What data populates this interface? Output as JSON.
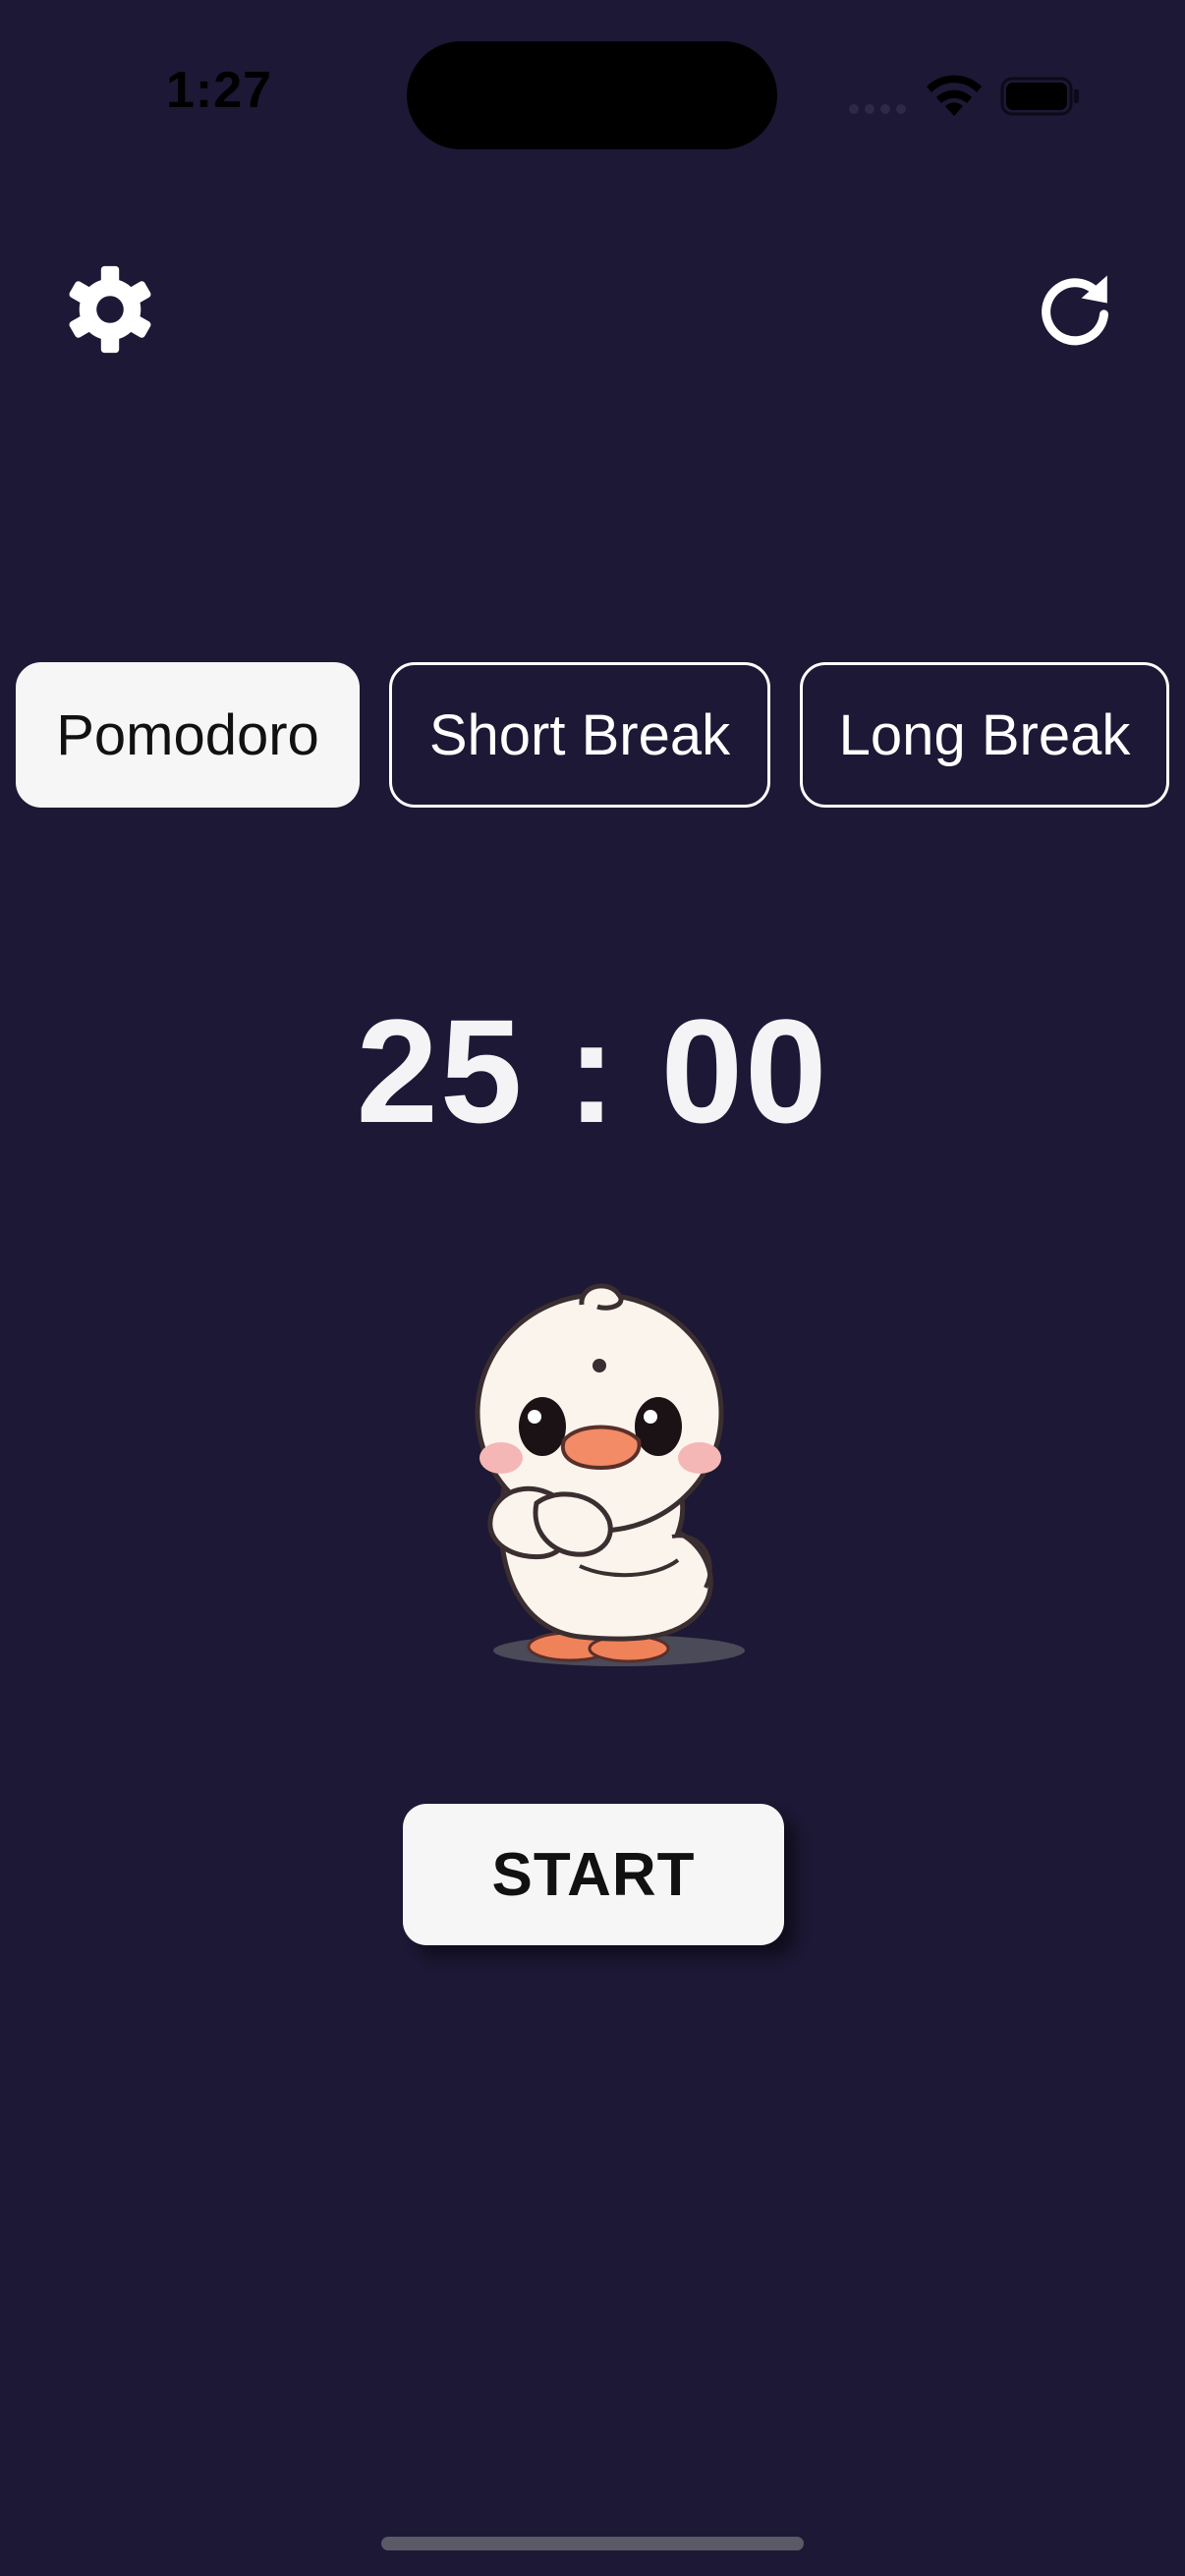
{
  "status_bar": {
    "time": "1:27",
    "icons": [
      "cellular-signal-icon",
      "wifi-icon",
      "battery-icon"
    ]
  },
  "toolbar": {
    "settings_icon": "gear-icon",
    "reset_icon": "refresh-icon"
  },
  "modes": {
    "selected": "Pomodoro",
    "items": [
      {
        "label": "Pomodoro",
        "active": true
      },
      {
        "label": "Short Break",
        "active": false
      },
      {
        "label": "Long Break",
        "active": false
      }
    ]
  },
  "timer": {
    "display": "25 : 00"
  },
  "mascot": {
    "icon": "duck-mascot-illustration"
  },
  "actions": {
    "start_label": "START"
  },
  "colors": {
    "background": "#1c1835",
    "foreground": "#ffffff",
    "button_fill": "#f6f6f7",
    "button_text": "#111111"
  }
}
